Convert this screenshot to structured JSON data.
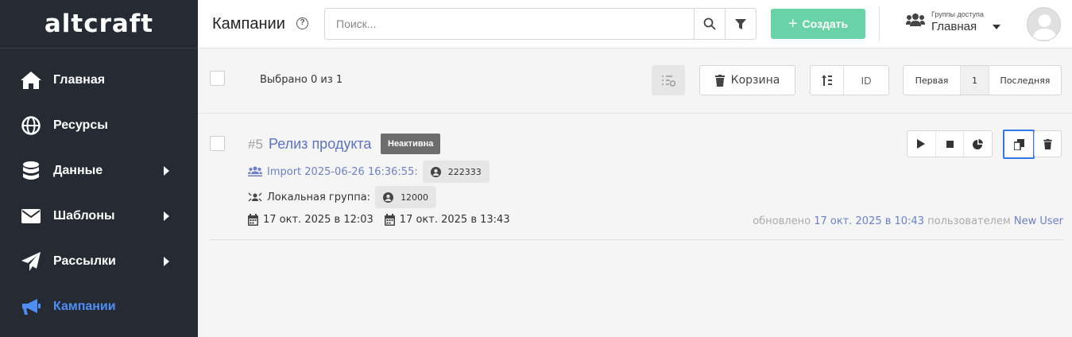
{
  "logo": "altcraft",
  "sidebar": {
    "items": [
      {
        "label": "Главная",
        "icon": "home-icon"
      },
      {
        "label": "Ресурсы",
        "icon": "globe-icon"
      },
      {
        "label": "Данные",
        "icon": "database-icon"
      },
      {
        "label": "Шаблоны",
        "icon": "envelope-icon"
      },
      {
        "label": "Рассылки",
        "icon": "paper-plane-icon"
      },
      {
        "label": "Кампании",
        "icon": "megaphone-icon"
      }
    ],
    "active_color": "#4e8df5"
  },
  "header": {
    "title": "Кампании",
    "search_placeholder": "Поиск...",
    "create_label": "Создать",
    "groups_caption": "Группы доступа",
    "groups_value": "Главная"
  },
  "toolbar": {
    "selected_text": "Выбрано 0 из 1",
    "trash_label": "Корзина",
    "sort_field": "ID",
    "pager": {
      "first": "Первая",
      "page": "1",
      "last": "Последняя"
    }
  },
  "campaign": {
    "id": "#5",
    "name": "Релиз продукта",
    "status": "Неактивна",
    "import_link": "Import 2025-06-26 16:36:55:",
    "import_count": "222333",
    "local_group_label": "Локальная группа:",
    "local_group_count": "12000",
    "start_date": "17 окт. 2025 в 12:03",
    "end_date": "17 окт. 2025 в 13:43",
    "updated_prefix": "обновлено",
    "updated_date": "17 окт. 2025 в 10:43",
    "updated_by_prefix": "пользователем",
    "updated_user": "New User"
  },
  "colors": {
    "sidebar_bg": "#262b33",
    "create_button": "#69d3a7",
    "link": "#5b73c7",
    "badge_bg": "#6d6d6d",
    "focus_border": "#2f78e6"
  }
}
